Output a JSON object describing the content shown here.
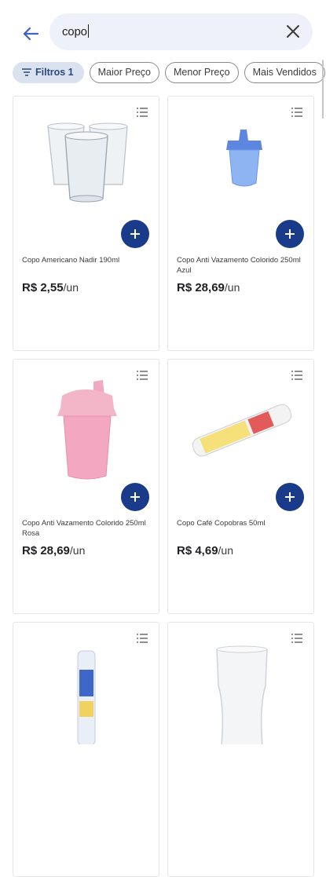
{
  "search": {
    "query": "copo"
  },
  "filters": {
    "chips": [
      "Filtros 1",
      "Maior Preço",
      "Menor Preço",
      "Mais Vendidos"
    ]
  },
  "products": [
    {
      "name": "Copo Americano Nadir 190ml",
      "price": "R$ 2,55",
      "unit": "/un"
    },
    {
      "name": "Copo Anti Vazamento Colorido 250ml Azul",
      "price": "R$ 28,69",
      "unit": "/un"
    },
    {
      "name": "Copo Anti Vazamento Colorido 250ml Rosa",
      "price": "R$ 28,69",
      "unit": "/un"
    },
    {
      "name": "Copo Café Copobras 50ml",
      "price": "R$ 4,69",
      "unit": "/un"
    },
    {
      "name": "",
      "price": "",
      "unit": ""
    },
    {
      "name": "",
      "price": "",
      "unit": ""
    }
  ],
  "colors": {
    "accent": "#1a3a8a",
    "search_bg": "#eef1fa",
    "chip_active_bg": "#dbe2ef"
  },
  "icons": {
    "back": "arrow-left-icon",
    "clear": "close-icon",
    "filter": "filter-icon",
    "add": "plus-icon",
    "list": "list-icon"
  }
}
